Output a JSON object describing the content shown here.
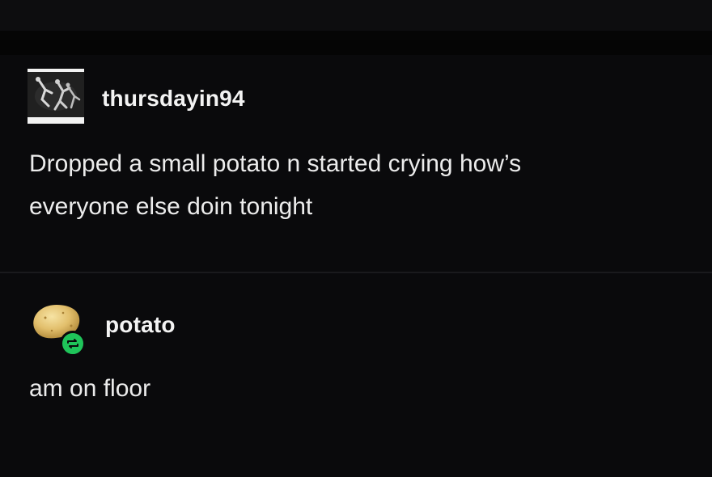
{
  "posts": [
    {
      "username": "thursdayin94",
      "avatar": "grayscale-dancers-photo",
      "text_lines": [
        "Dropped a small potato n started crying how’s",
        "everyone else doin tonight"
      ]
    },
    {
      "username": "potato",
      "avatar": "potato-icon",
      "badge": "reblog-icon",
      "badge_color": "#1fc45a",
      "text_lines": [
        "am on floor"
      ]
    }
  ]
}
